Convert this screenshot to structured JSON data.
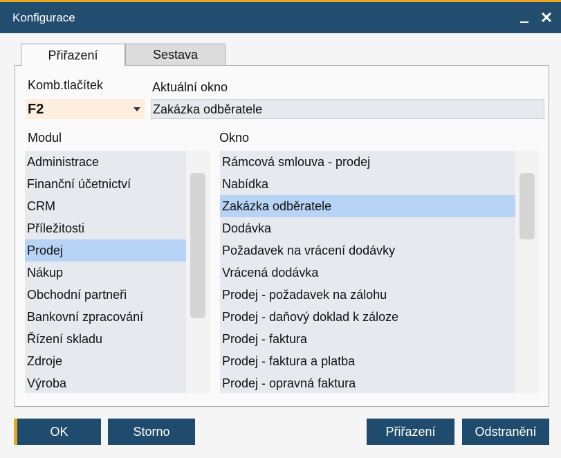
{
  "window": {
    "title": "Konfigurace"
  },
  "tabs": [
    {
      "label": "Přiřazení",
      "active": true
    },
    {
      "label": "Sestava",
      "active": false
    }
  ],
  "button_combo": {
    "label": "Komb.tlačítek",
    "value": "F2"
  },
  "current_window": {
    "label": "Aktuální okno",
    "value": "Zakázka odběratele"
  },
  "module_list": {
    "label": "Modul",
    "items": [
      "Administrace",
      "Finanční účetnictví",
      "CRM",
      "Příležitosti",
      "Prodej",
      "Nákup",
      "Obchodní partneři",
      "Bankovní zpracování",
      "Řízení skladu",
      "Zdroje",
      "Výroba"
    ],
    "selected": "Prodej"
  },
  "window_list": {
    "label": "Okno",
    "items": [
      "Rámcová smlouva - prodej",
      "Nabídka",
      "Zakázka odběratele",
      "Dodávka",
      "Požadavek na vrácení dodávky",
      "Vrácená dodávka",
      "Prodej - požadavek na zálohu",
      "Prodej - daňový doklad k záloze",
      "Prodej - faktura",
      "Prodej - faktura a platba",
      "Prodej - opravná faktura"
    ],
    "selected": "Zakázka odběratele"
  },
  "buttons": {
    "ok": "OK",
    "cancel": "Storno",
    "assign": "Přiřazení",
    "remove": "Odstranění"
  },
  "colors": {
    "titlebar": "#234d6e",
    "accent": "#e8a820",
    "button": "#1f4b6e",
    "selection": "#b7d4f6",
    "list_bg": "#e6eaef"
  }
}
